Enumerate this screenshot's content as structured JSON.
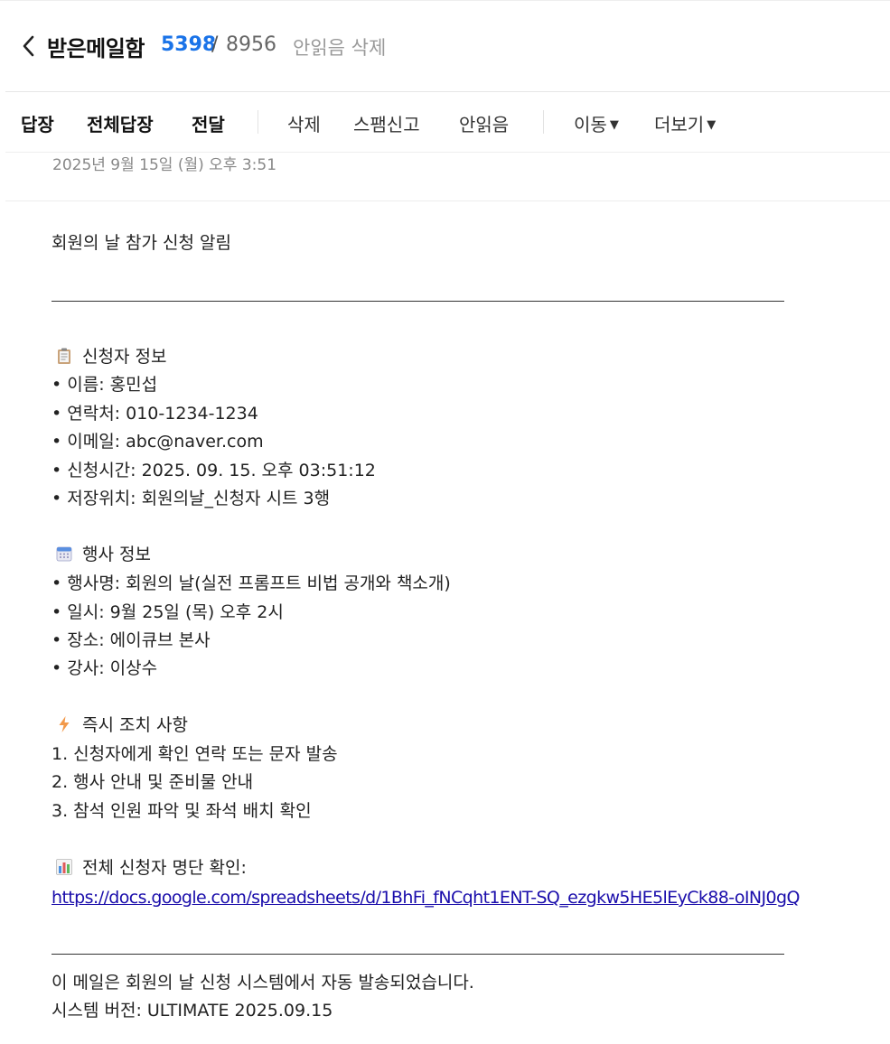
{
  "header": {
    "title": "받은메일함",
    "unread_count": "5398",
    "separator": "/",
    "total_count": "8956",
    "action_delete_unread": "안읽음 삭제"
  },
  "toolbar": {
    "reply": "답장",
    "reply_all": "전체답장",
    "forward": "전달",
    "delete": "삭제",
    "report_spam": "스팸신고",
    "mark_unread": "안읽음",
    "move": "이동",
    "more": "더보기"
  },
  "mail": {
    "date": "2025년 9월 15일 (월) 오후 3:51",
    "subject_line": "회원의 날 참가 신청 알림",
    "applicant": {
      "heading": "신청자 정보",
      "name": "• 이름: 홍민섭",
      "contact": "• 연락처: 010-1234-1234",
      "email": "• 이메일: abc@naver.com",
      "time": "• 신청시간: 2025. 09. 15. 오후 03:51:12",
      "location": "• 저장위치: 회원의날_신청자 시트 3행"
    },
    "event": {
      "heading": "행사 정보",
      "name": "• 행사명: 회원의 날(실전 프롬프트 비법 공개와 책소개)",
      "datetime": "• 일시: 9월 25일 (목) 오후 2시",
      "place": "• 장소: 에이큐브 본사",
      "speaker": "• 강사: 이상수"
    },
    "actions": {
      "heading": "즉시 조치 사항",
      "item1": "1. 신청자에게 확인 연락 또는 문자 발송",
      "item2": "2. 행사 안내 및 준비물 안내",
      "item3": "3. 참석 인원 파악 및 좌석 배치 확인"
    },
    "list": {
      "heading": "전체 신청자 명단 확인:",
      "url": "https://docs.google.com/spreadsheets/d/1BhFi_fNCqht1ENT-SQ_ezgkw5HE5lEyCk88-oINJ0gQ"
    },
    "footer": {
      "line1": "이 메일은 회원의 날 신청 시스템에서 자동 발송되었습니다.",
      "line2": "시스템 버전: ULTIMATE 2025.09.15"
    }
  },
  "icons": {
    "back": "chevron-left-icon",
    "clipboard": "clipboard-icon",
    "calendar": "calendar-icon",
    "lightning": "lightning-icon",
    "chart": "bar-chart-icon",
    "caret": "caret-down-icon"
  },
  "colors": {
    "accent": "#1a73e8",
    "link": "#1a0dab"
  }
}
